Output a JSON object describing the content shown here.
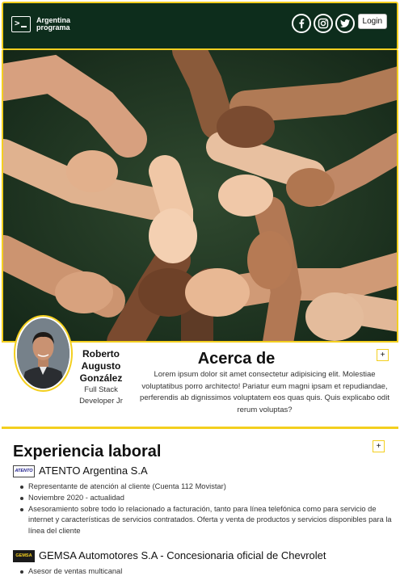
{
  "navbar": {
    "brand": "Argentina programa",
    "social_icons": [
      "facebook-icon",
      "instagram-icon",
      "twitter-icon"
    ],
    "login_label": "Login"
  },
  "profile": {
    "name": "Roberto Augusto González",
    "role": "Full Stack Developer Jr"
  },
  "about": {
    "title": "Acerca de",
    "text": "Lorem ipsum dolor sit amet consectetur adipisicing elit. Molestiae voluptatibus porro architecto! Pariatur eum magni ipsam et repudiandae, perferendis ab dignissimos voluptatem eos quas quis. Quis explicabo odit rerum voluptas?",
    "add_label": "+"
  },
  "experience": {
    "title": "Experiencia laboral",
    "add_label": "+",
    "jobs": [
      {
        "logo_text": "ATENTO",
        "company": "ATENTO Argentina S.A",
        "details": [
          "Representante de atención al cliente (Cuenta 112 Movistar)",
          "Noviembre 2020 - actualidad",
          "Asesoramiento sobre todo lo relacionado a facturación, tanto para línea telefónica como para servicio de internet y características de servicios contratados. Oferta y venta de productos y servicios disponibles para la línea del cliente"
        ]
      },
      {
        "logo_text": "GEMSA",
        "company": "GEMSA Automotores S.A - Concesionaria oficial de Chevrolet",
        "details": [
          "Asesor de ventas multicanal"
        ]
      }
    ]
  },
  "colors": {
    "accent": "#f3cf1f",
    "navbar_bg": "#0d2d1c"
  }
}
